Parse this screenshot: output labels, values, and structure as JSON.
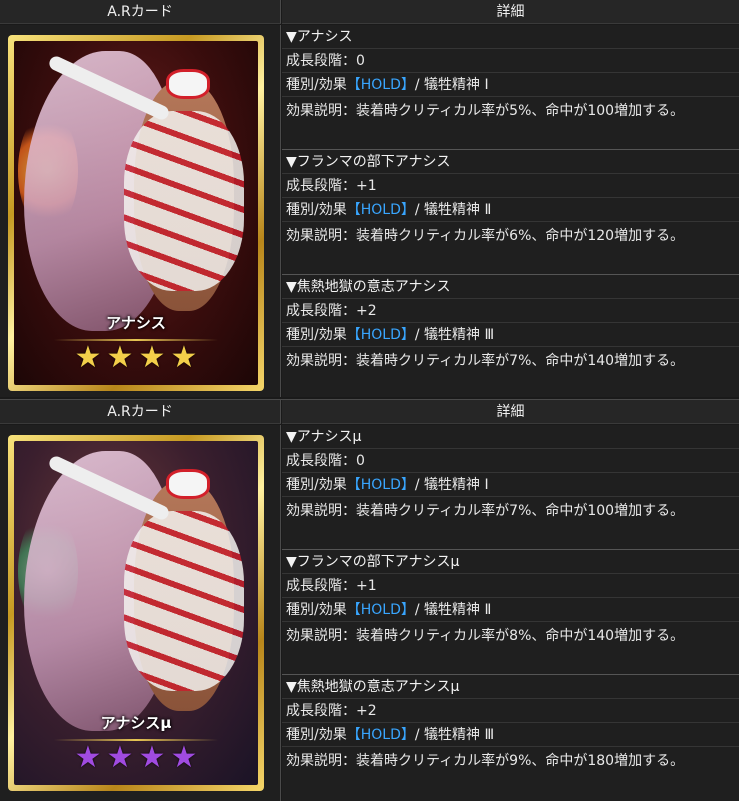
{
  "sections": [
    {
      "card_header": "A.Rカード",
      "detail_header": "詳細",
      "card_name": "アナシス",
      "star_count": 4,
      "star_color": "#f3cf4a",
      "levels": [
        {
          "title": "▼アナシス",
          "growth": "成長段階：0",
          "type_prefix": "種別/効果",
          "hold": "【HOLD】",
          "type_suffix": "/  犠牲精神 Ⅰ",
          "desc": "効果説明：装着時クリティカル率が5%、命中が100増加する。"
        },
        {
          "title": "▼フランマの部下アナシス",
          "growth": "成長段階：+1",
          "type_prefix": "種別/効果",
          "hold": "【HOLD】",
          "type_suffix": "/  犠牲精神 Ⅱ",
          "desc": "効果説明：装着時クリティカル率が6%、命中が120増加する。"
        },
        {
          "title": "▼焦熱地獄の意志アナシス",
          "growth": "成長段階：+2",
          "type_prefix": "種別/効果",
          "hold": "【HOLD】",
          "type_suffix": "/  犠牲精神 Ⅲ",
          "desc": "効果説明：装着時クリティカル率が7%、命中が140増加する。"
        }
      ]
    },
    {
      "card_header": "A.Rカード",
      "detail_header": "詳細",
      "card_name": "アナシスμ",
      "star_count": 4,
      "star_color": "#a04be0",
      "levels": [
        {
          "title": "▼アナシスμ",
          "growth": "成長段階：0",
          "type_prefix": "種別/効果",
          "hold": "【HOLD】",
          "type_suffix": "/  犠牲精神 Ⅰ",
          "desc": "効果説明：装着時クリティカル率が7%、命中が100増加する。"
        },
        {
          "title": "▼フランマの部下アナシスμ",
          "growth": "成長段階：+1",
          "type_prefix": "種別/効果",
          "hold": "【HOLD】",
          "type_suffix": "/  犠牲精神 Ⅱ",
          "desc": "効果説明：装着時クリティカル率が8%、命中が140増加する。"
        },
        {
          "title": "▼焦熱地獄の意志アナシスμ",
          "growth": "成長段階：+2",
          "type_prefix": "種別/効果",
          "hold": "【HOLD】",
          "type_suffix": "/  犠牲精神 Ⅲ",
          "desc": "効果説明：装着時クリティカル率が9%、命中が180増加する。"
        }
      ]
    }
  ]
}
